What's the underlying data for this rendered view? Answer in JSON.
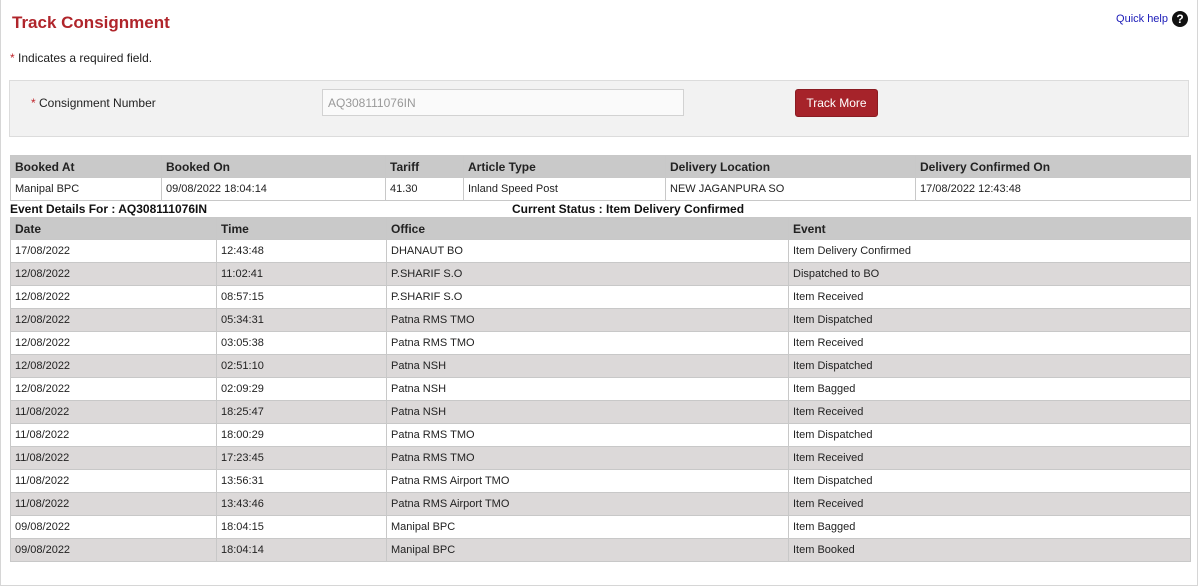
{
  "page": {
    "title": "Track Consignment",
    "quick_help": "Quick help",
    "help_icon": "question-circle-icon",
    "required_marker": "*",
    "required_note": "Indicates a required field."
  },
  "form": {
    "label": "Consignment Number",
    "consignment_value": "AQ308111076IN",
    "button_label": "Track More"
  },
  "booking": {
    "headers": [
      "Booked At",
      "Booked On",
      "Tariff",
      "Article Type",
      "Delivery Location",
      "Delivery Confirmed On"
    ],
    "row": [
      "Manipal BPC",
      "09/08/2022 18:04:14",
      "41.30",
      "Inland Speed Post",
      "NEW JAGANPURA SO",
      "17/08/2022 12:43:48"
    ]
  },
  "events": {
    "details_label": "Event Details For : AQ308111076IN",
    "status_label": "Current Status : Item Delivery Confirmed",
    "headers": [
      "Date",
      "Time",
      "Office",
      "Event"
    ],
    "rows": [
      [
        "17/08/2022",
        "12:43:48",
        "DHANAUT BO",
        "Item Delivery Confirmed"
      ],
      [
        "12/08/2022",
        "11:02:41",
        "P.SHARIF S.O",
        "Dispatched to BO"
      ],
      [
        "12/08/2022",
        "08:57:15",
        "P.SHARIF S.O",
        "Item Received"
      ],
      [
        "12/08/2022",
        "05:34:31",
        "Patna RMS TMO",
        "Item Dispatched"
      ],
      [
        "12/08/2022",
        "03:05:38",
        "Patna RMS TMO",
        "Item Received"
      ],
      [
        "12/08/2022",
        "02:51:10",
        "Patna NSH",
        "Item Dispatched"
      ],
      [
        "12/08/2022",
        "02:09:29",
        "Patna NSH",
        "Item Bagged"
      ],
      [
        "11/08/2022",
        "18:25:47",
        "Patna NSH",
        "Item Received"
      ],
      [
        "11/08/2022",
        "18:00:29",
        "Patna RMS TMO",
        "Item Dispatched"
      ],
      [
        "11/08/2022",
        "17:23:45",
        "Patna RMS TMO",
        "Item Received"
      ],
      [
        "11/08/2022",
        "13:56:31",
        "Patna RMS Airport TMO",
        "Item Dispatched"
      ],
      [
        "11/08/2022",
        "13:43:46",
        "Patna RMS Airport TMO",
        "Item Received"
      ],
      [
        "09/08/2022",
        "18:04:15",
        "Manipal BPC",
        "Item Bagged"
      ],
      [
        "09/08/2022",
        "18:04:14",
        "Manipal BPC",
        "Item Booked"
      ]
    ]
  },
  "colors": {
    "brand_red": "#b0252b",
    "button_red": "#a6232a",
    "header_gray": "#c9c9c9",
    "row_alt": "#dcd9d9",
    "link_blue": "#1a1ab8"
  }
}
